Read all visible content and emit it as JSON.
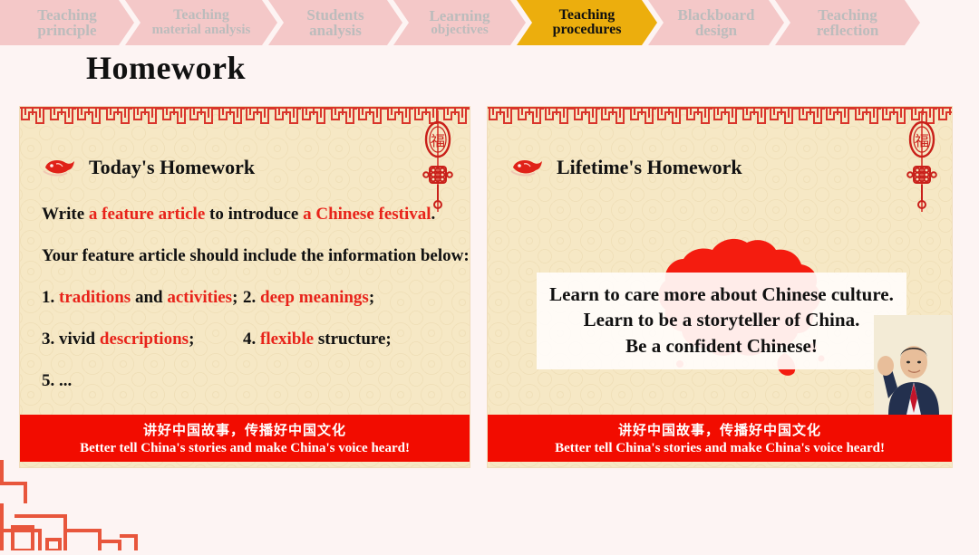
{
  "nav": {
    "steps": [
      {
        "line1": "Teaching",
        "line2": "principle",
        "active": false
      },
      {
        "line1": "Teaching",
        "line2": "material analysis",
        "active": false
      },
      {
        "line1": "Students",
        "line2": "analysis",
        "active": false
      },
      {
        "line1": "Learning",
        "line2": "objectives",
        "active": false
      },
      {
        "line1": "Teaching",
        "line2": "procedures",
        "active": true
      },
      {
        "line1": "Blackboard",
        "line2": "design",
        "active": false
      },
      {
        "line1": "Teaching",
        "line2": "reflection",
        "active": false
      }
    ],
    "active_color": "#ECAE0D",
    "inactive_color": "#F4C8C8"
  },
  "page_title": "Homework",
  "left_card": {
    "icon": "red-fish-papercut-icon",
    "heading": "Today's Homework",
    "line1": {
      "parts": [
        {
          "text": "Write ",
          "red": false
        },
        {
          "text": "a feature article",
          "red": true
        },
        {
          "text": " to introduce ",
          "red": false
        },
        {
          "text": "a Chinese festival",
          "red": true
        },
        {
          "text": ".",
          "red": false
        }
      ]
    },
    "line2": {
      "parts": [
        {
          "text": "Your feature article should include the information below:",
          "red": false
        }
      ]
    },
    "item1": {
      "parts": [
        {
          "text": "1. ",
          "red": false
        },
        {
          "text": "traditions",
          "red": true
        },
        {
          "text": " and ",
          "red": false
        },
        {
          "text": "activities",
          "red": true
        },
        {
          "text": ";",
          "red": false
        }
      ]
    },
    "item2": {
      "parts": [
        {
          "text": "2. ",
          "red": false
        },
        {
          "text": "deep meanings",
          "red": true
        },
        {
          "text": ";",
          "red": false
        }
      ]
    },
    "item3": {
      "parts": [
        {
          "text": "3. vivid ",
          "red": false
        },
        {
          "text": "descriptions",
          "red": true
        },
        {
          "text": ";",
          "red": false
        }
      ]
    },
    "item4": {
      "parts": [
        {
          "text": "4. ",
          "red": false
        },
        {
          "text": "flexible",
          "red": true
        },
        {
          "text": " structure;",
          "red": false
        }
      ]
    },
    "item5": {
      "parts": [
        {
          "text": "5. ...",
          "red": false
        }
      ]
    },
    "footer_cn": "讲好中国故事，传播好中国文化",
    "footer_en": "Better tell China's stories and make China's voice heard!"
  },
  "right_card": {
    "icon": "red-fish-papercut-icon",
    "heading": "Lifetime's Homework",
    "quote_lines": [
      "Learn to care more about Chinese culture.",
      "Learn to be a storyteller of China.",
      "Be a confident Chinese!"
    ],
    "background_graphic": "china-map-silhouette",
    "portrait": "waving-man-portrait-photo",
    "footer_cn": "讲好中国故事，传播好中国文化",
    "footer_en": "Better tell China's stories and make China's voice heard!"
  },
  "decor": {
    "pendant": "chinese-fu-lantern-knot-ornament",
    "corner": "chinese-meander-corner-ornament",
    "border": "chinese-meander-border",
    "card_bg": "#F6E8C5",
    "red": "#F20C00",
    "text_red": "#E8231A"
  }
}
